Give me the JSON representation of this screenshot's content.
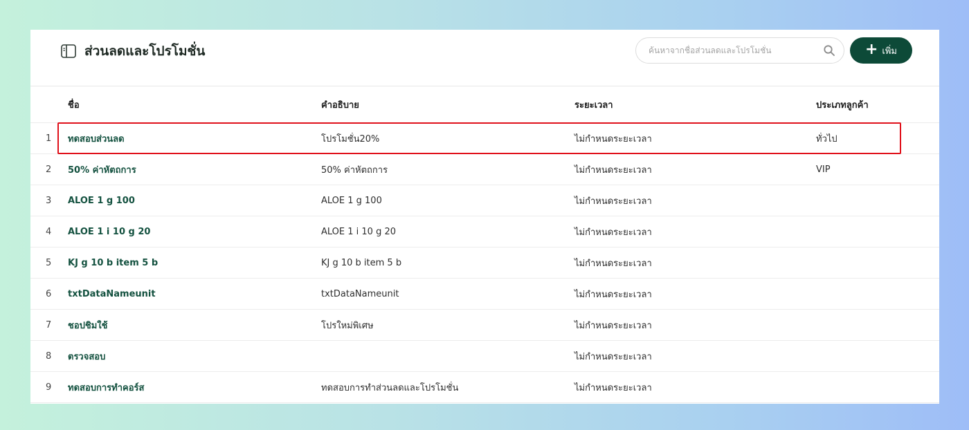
{
  "header": {
    "title": "ส่วนลดและโปรโมชั่น",
    "search_placeholder": "ค้นหาจากชื่อส่วนลดและโปรโมชั่น",
    "add_button_label": "เพิ่ม"
  },
  "table": {
    "columns": {
      "name": "ชื่อ",
      "description": "คำอธิบาย",
      "period": "ระยะเวลา",
      "customer_type": "ประเภทลูกค้า"
    },
    "rows": [
      {
        "num": "1",
        "name": "ทดสอบส่วนลด",
        "description": "โปรโมชั่น20%",
        "period": "ไม่กำหนดระยะเวลา",
        "customer_type": "ทั่วไป"
      },
      {
        "num": "2",
        "name": "50% ค่าหัตถการ",
        "description": "50% ค่าหัตถการ",
        "period": "ไม่กำหนดระยะเวลา",
        "customer_type": "VIP"
      },
      {
        "num": "3",
        "name": "ALOE 1 g 100",
        "description": "ALOE 1 g 100",
        "period": "ไม่กำหนดระยะเวลา",
        "customer_type": ""
      },
      {
        "num": "4",
        "name": "ALOE 1 i 10 g 20",
        "description": "ALOE 1 i 10 g 20",
        "period": "ไม่กำหนดระยะเวลา",
        "customer_type": ""
      },
      {
        "num": "5",
        "name": "KJ g 10 b item 5 b",
        "description": "KJ g 10 b item 5 b",
        "period": "ไม่กำหนดระยะเวลา",
        "customer_type": ""
      },
      {
        "num": "6",
        "name": "txtDataNameunit",
        "description": "txtDataNameunit",
        "period": "ไม่กำหนดระยะเวลา",
        "customer_type": ""
      },
      {
        "num": "7",
        "name": "ชอปชิมใช้",
        "description": "โปรใหม่พิเศษ",
        "period": "ไม่กำหนดระยะเวลา",
        "customer_type": ""
      },
      {
        "num": "8",
        "name": "ตรวจสอบ",
        "description": "",
        "period": "ไม่กำหนดระยะเวลา",
        "customer_type": ""
      },
      {
        "num": "9",
        "name": "ทดสอบการทำคอร์ส",
        "description": "ทดสอบการทำส่วนลดและโปรโมชั่น",
        "period": "ไม่กำหนดระยะเวลา",
        "customer_type": ""
      }
    ]
  },
  "colors": {
    "accent": "#0d4a38",
    "name_text": "#13513f",
    "highlight": "#e0101a"
  },
  "icons": {
    "title": "sidebar-panel-icon",
    "search": "search-icon",
    "add": "plus-icon"
  }
}
